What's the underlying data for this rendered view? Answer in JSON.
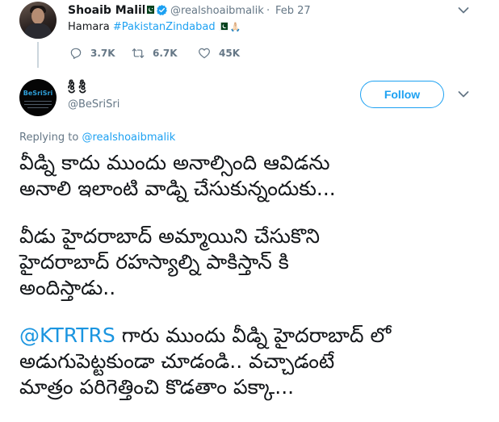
{
  "parent_tweet": {
    "author_name": "Shoaib Malik",
    "handle": "@realshoaibmalik",
    "separator": "·",
    "date": "Feb 27",
    "text_prefix": "Hamara ",
    "hashtag": "#PakistanZindabad",
    "emoji_pray": "🙏🏻",
    "reply_count": "3.7K",
    "retweet_count": "6.7K",
    "like_count": "45K"
  },
  "reply_tweet": {
    "author_name": "శ్రీ శ్రీ",
    "handle": "@BeSriSri",
    "avatar_text": "BeSriSri",
    "follow_label": "Follow",
    "replying_prefix": "Replying to ",
    "replying_to": "@realshoaibmalik",
    "paragraphs": [
      [
        "వీడ్ని కాదు ముందు అనాల్సింది ఆవిడను",
        "అనాలి ఇలాంటి వాడ్ని చేసుకున్నందుకు..."
      ],
      [
        "వీడు హైదరాబాద్ అమ్మాయిని చేసుకొని",
        "హైదరాబాద్ రహస్యాల్ని పాకిస్తాన్ కి",
        "అందిస్తాడు.."
      ]
    ],
    "last_paragraph": {
      "mention": "@KTRTRS",
      "line1_rest": " గారు ముందు వీడ్ని హైదరాబాద్ లో",
      "line2": "అడుగుపెట్టకుండా చూడండి.. వచ్చాడంటే",
      "line3": "మాత్రం పరిగెత్తించి కొడతాం పక్కా..."
    }
  },
  "colors": {
    "link_blue": "#1da1f2",
    "secondary_gray": "#657786",
    "verified_blue": "#1da1f2",
    "pakistan_green": "#01411c"
  },
  "icons": {
    "reply": "reply-icon",
    "retweet": "retweet-icon",
    "like": "heart-icon",
    "verified": "verified-badge-icon",
    "caret": "chevron-down-icon",
    "flag": "pakistan-flag-icon"
  }
}
